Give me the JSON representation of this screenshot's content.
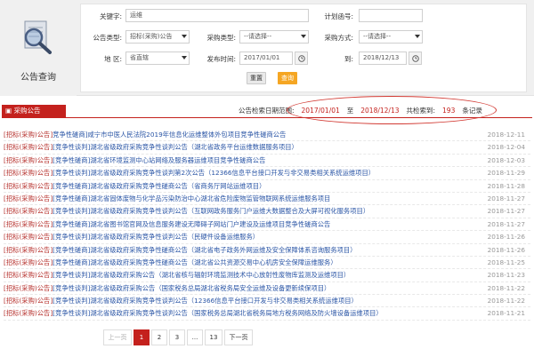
{
  "panel": {
    "title": "公告查询"
  },
  "form": {
    "keyword": {
      "label": "关键字:",
      "value": "运维"
    },
    "plan_no": {
      "label": "计划函号:",
      "value": ""
    },
    "notice_type": {
      "label": "公告类型:",
      "value": "招标(采购)公告"
    },
    "purchase_type": {
      "label": "采购类型:",
      "value": "--请选择--"
    },
    "purchase_method": {
      "label": "采购方式:",
      "value": "--请选择--"
    },
    "region": {
      "label": "地  区:",
      "value": "省直辖"
    },
    "publish_from": {
      "label": "发布时间:",
      "value": "2017/01/01"
    },
    "publish_to": {
      "label": "到:",
      "value": "2018/12/13"
    },
    "reset_label": "重置",
    "search_label": "查询"
  },
  "results": {
    "tab_label": "采购公告",
    "summary": {
      "range_label": "公告检索日期范围:",
      "from": "2017/01/01",
      "to_word": "至",
      "to": "2018/12/13",
      "count_label": "共检索到:",
      "count": "193",
      "unit": "条记录"
    },
    "items": [
      {
        "category": "[招标(采购)公告]",
        "title": "竞争性磋商]咸宁市中医人民法院2019年信息化运维整体外包项目竞争性磋商公告",
        "date": "2018-12-11"
      },
      {
        "category": "[招标(采购)公告]",
        "title": "[竞争性谈判]湖北省级政府采购竞争性谈判公告（湖北省政务平台运维数据服务项目）",
        "date": "2018-12-04"
      },
      {
        "category": "[招标(采购)公告]",
        "title": "[竞争性磋商]湖北省环境监测中心站网络及服务器运维项目竞争性磋商公告",
        "date": "2018-12-03"
      },
      {
        "category": "[招标(采购)公告]",
        "title": "[竞争性谈判]湖北省级政府采购竞争性谈判第2次公告（12366信息平台接口开发与非交易类相关系统运维项目）",
        "date": "2018-11-29"
      },
      {
        "category": "[招标(采购)公告]",
        "title": "[竞争性磋商]湖北省级政府采购竞争性磋商公告（省商务厅网站运维项目）",
        "date": "2018-11-28"
      },
      {
        "category": "[招标(采购)公告]",
        "title": "[竞争性磋商]湖北省固体废物与化学品污染防治中心湖北省危险废物监管物联网系统运维服务项目",
        "date": "2018-11-27"
      },
      {
        "category": "[招标(采购)公告]",
        "title": "[竞争性谈判]湖北省级政府采购竞争性谈判公告（互联网政务服务门户运维大数据整合及大屏可视化服务项目）",
        "date": "2018-11-27"
      },
      {
        "category": "[招标(采购)公告]",
        "title": "[竞争性磋商]湖北省图书馆官网及信息服务建设无障碍子网站门户建设及运维项目竞争性磋商公告",
        "date": "2018-11-27"
      },
      {
        "category": "[招标(采购)公告]",
        "title": "[竞争性谈判]湖北省级政府采购竞争性谈判公告（民硬件设备运维服务）",
        "date": "2018-11-26"
      },
      {
        "category": "[招标(采购)公告]",
        "title": "[竞争性磋商]湖北省级政府采购竞争性磋商公告（湖北省电子政务外网运维及安全保障体系咨询服务项目）",
        "date": "2018-11-26"
      },
      {
        "category": "[招标(采购)公告]",
        "title": "[竞争性磋商]湖北省级政府采购竞争性磋商公告（湖北省公共资源交易中心机房安全保障运维服务）",
        "date": "2018-11-25"
      },
      {
        "category": "[招标(采购)公告]",
        "title": "[竞争性谈判]湖北省级政府采购公告（湖北省核与辐射环境监测技术中心放射性废物库监测及运维项目）",
        "date": "2018-11-23"
      },
      {
        "category": "[招标(采购)公告]",
        "title": "[竞争性谈判]湖北省级政府采购公告（国家税务总局湖北省税务局安全运维及设备更新续保项目）",
        "date": "2018-11-22"
      },
      {
        "category": "[招标(采购)公告]",
        "title": "[竞争性谈判]湖北省级政府采购竞争性谈判公告（12366信息平台接口开发与非交易类相关系统运维项目）",
        "date": "2018-11-22"
      },
      {
        "category": "[招标(采购)公告]",
        "title": "[竞争性谈判]湖北省级政府采购竞争性谈判公告（国家税务总局湖北省税务局地方税务网络及防火墙设备运维项目）",
        "date": "2018-11-21"
      }
    ]
  },
  "pagination": {
    "prev": "上一页",
    "pages": [
      "1",
      "2",
      "3",
      "...",
      "13"
    ],
    "next": "下一页"
  },
  "colors": {
    "accent_red": "#c4211d",
    "search_orange": "#f5a623",
    "link_blue": "#2b56a6"
  }
}
